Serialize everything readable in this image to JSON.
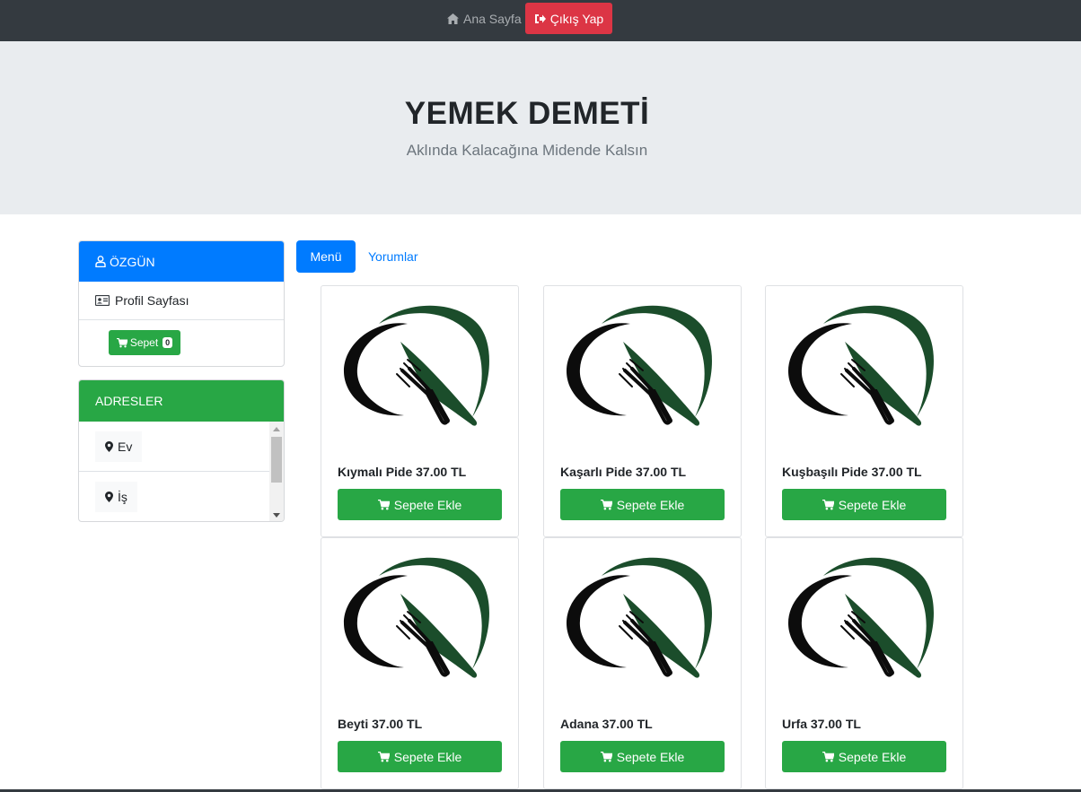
{
  "nav": {
    "home_label": "Ana Sayfa",
    "logout_label": "Çıkış Yap"
  },
  "hero": {
    "title": "YEMEK DEMETİ",
    "subtitle": "Aklında Kalacağına Midende Kalsın"
  },
  "user_card": {
    "username": "ÖZGÜN",
    "profile_label": "Profil Sayfası",
    "cart_label": "Sepet",
    "cart_count": "0"
  },
  "address_card": {
    "title": "ADRESLER",
    "items": [
      "Ev",
      "İş"
    ]
  },
  "tabs": {
    "menu": "Menü",
    "reviews": "Yorumlar"
  },
  "products": [
    {
      "name": "Kıymalı Pide 37.00 TL",
      "button": "Sepete Ekle"
    },
    {
      "name": "Kaşarlı Pide 37.00 TL",
      "button": "Sepete Ekle"
    },
    {
      "name": "Kuşbaşılı Pide 37.00 TL",
      "button": "Sepete Ekle"
    },
    {
      "name": "Beyti 37.00 TL",
      "button": "Sepete Ekle"
    },
    {
      "name": "Adana 37.00 TL",
      "button": "Sepete Ekle"
    },
    {
      "name": "Urfa 37.00 TL",
      "button": "Sepete Ekle"
    }
  ],
  "colors": {
    "navbar": "#343a40",
    "danger": "#dc3545",
    "primary": "#007bff",
    "success": "#28a745",
    "hero_bg": "#e9ecef",
    "logo_green": "#1b4d2b"
  },
  "icons": {
    "home": "home-icon",
    "logout": "sign-out-icon",
    "user": "user-icon",
    "profile": "id-card-icon",
    "cart": "shopping-cart-icon",
    "address": "map-marker-icon",
    "logo": "plate-fork-knife-logo"
  }
}
